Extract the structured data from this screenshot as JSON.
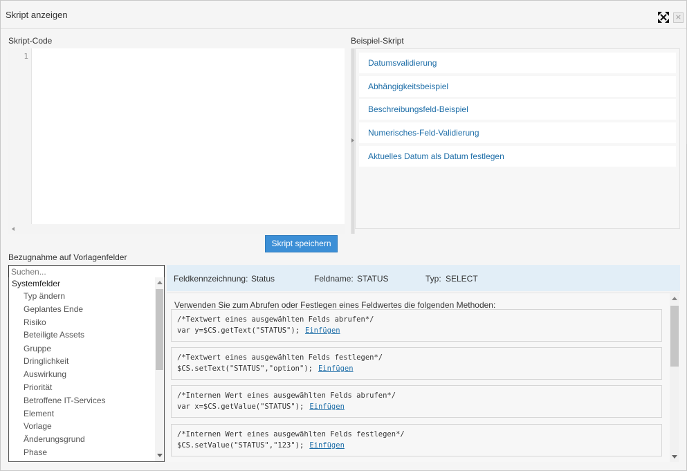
{
  "dialog": {
    "title": "Skript anzeigen",
    "maximize_icon": "expand-arrows-icon",
    "close_icon": "close-icon",
    "close_glyph": "×"
  },
  "editor": {
    "label": "Skript-Code",
    "line_number": "1",
    "content": ""
  },
  "examples": {
    "label": "Beispiel-Skript",
    "items": [
      "Datumsvalidierung",
      "Abhängigkeitsbeispiel",
      "Beschreibungsfeld-Beispiel",
      "Numerisches-Feld-Validierung",
      "Aktuelles Datum als Datum festlegen"
    ]
  },
  "save_button": "Skript speichern",
  "fields": {
    "label": "Bezugnahme auf Vorlagenfelder",
    "search_placeholder": "Suchen...",
    "group": "Systemfelder",
    "items": [
      "Typ ändern",
      "Geplantes Ende",
      "Risiko",
      "Beteiligte Assets",
      "Gruppe",
      "Dringlichkeit",
      "Auswirkung",
      "Priorität",
      "Betroffene IT-Services",
      "Element",
      "Vorlage",
      "Änderungsgrund",
      "Phase"
    ]
  },
  "field_info": {
    "id_label": "Feldkennzeichnung:",
    "id_value": "Status",
    "name_label": "Feldname:",
    "name_value": "STATUS",
    "type_label": "Typ:",
    "type_value": "SELECT"
  },
  "methods": {
    "description": "Verwenden Sie zum Abrufen oder Festlegen eines Feldwertes die folgenden Methoden:",
    "insert_label": "Einfügen",
    "blocks": [
      {
        "comment": "/*Textwert eines ausgewählten Felds abrufen*/",
        "code": "var y=$CS.getText(\"STATUS\");"
      },
      {
        "comment": "/*Textwert eines ausgewählten Felds festlegen*/",
        "code": "$CS.setText(\"STATUS\",\"option\");"
      },
      {
        "comment": "/*Internen Wert eines ausgewählten Felds abrufen*/",
        "code": "var x=$CS.getValue(\"STATUS\");"
      },
      {
        "comment": "/*Internen Wert eines ausgewählten Felds festlegen*/",
        "code": "$CS.setValue(\"STATUS\",\"123\");"
      }
    ]
  },
  "colors": {
    "accent": "#3c8fd6",
    "link": "#1e6ea8",
    "info_bar": "#e2eef7"
  }
}
